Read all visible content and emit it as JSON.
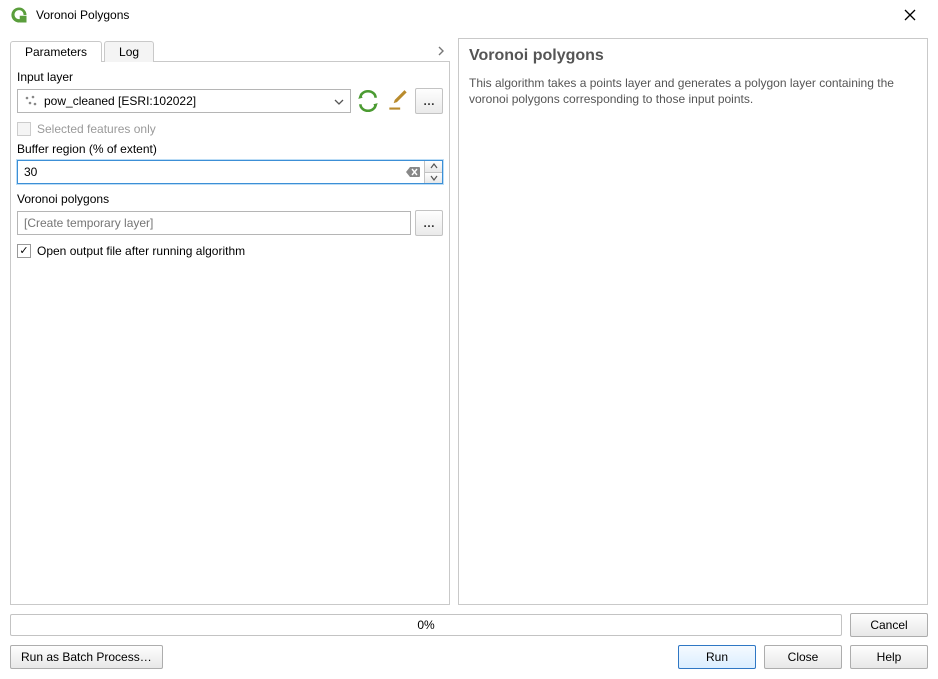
{
  "window": {
    "title": "Voronoi Polygons"
  },
  "tabs": {
    "parameters": "Parameters",
    "log": "Log"
  },
  "params": {
    "input_label": "Input layer",
    "input_value": "pow_cleaned [ESRI:102022]",
    "selected_only_label": "Selected features only",
    "buffer_label": "Buffer region (% of extent)",
    "buffer_value": "30",
    "output_label": "Voronoi polygons",
    "output_placeholder": "[Create temporary layer]",
    "open_output_label": "Open output file after running algorithm"
  },
  "help": {
    "title": "Voronoi polygons",
    "text": "This algorithm takes a points layer and generates a polygon layer containing the voronoi polygons corresponding to those input points."
  },
  "footer": {
    "progress_text": "0%",
    "cancel": "Cancel",
    "batch": "Run as Batch Process…",
    "run": "Run",
    "close": "Close",
    "help_btn": "Help"
  }
}
